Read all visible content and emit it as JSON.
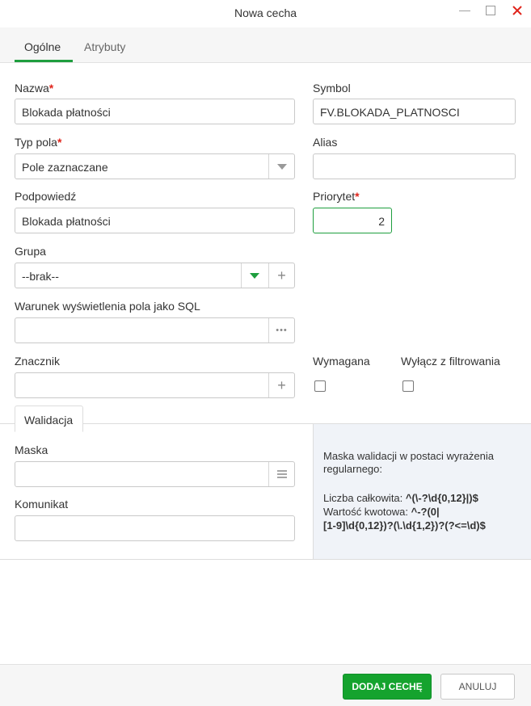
{
  "window": {
    "title": "Nowa cecha",
    "minimize_icon": "minimize-icon",
    "maximize_icon": "maximize-icon",
    "close_icon": "close-icon",
    "close_color": "#e0241b"
  },
  "tabs": [
    {
      "label": "Ogólne",
      "active": true
    },
    {
      "label": "Atrybuty",
      "active": false
    }
  ],
  "accent": "#1e9e3e",
  "form": {
    "name": {
      "label": "Nazwa",
      "required": true,
      "value": "Blokada płatności"
    },
    "symbol": {
      "label": "Symbol",
      "value": "FV.BLOKADA_PLATNOSCI"
    },
    "field_type": {
      "label": "Typ pola",
      "required": true,
      "value": "Pole zaznaczane"
    },
    "alias": {
      "label": "Alias",
      "value": ""
    },
    "hint": {
      "label": "Podpowiedź",
      "value": "Blokada płatności"
    },
    "priority": {
      "label": "Priorytet",
      "required": true,
      "value": "2"
    },
    "group": {
      "label": "Grupa",
      "value": "--brak--"
    },
    "sql_condition": {
      "label": "Warunek wyświetlenia pola jako SQL",
      "value": ""
    },
    "marker": {
      "label": "Znacznik",
      "value": ""
    },
    "required_flag": {
      "label": "Wymagana",
      "checked": false
    },
    "exclude_filter": {
      "label": "Wyłącz z filtrowania",
      "checked": false
    }
  },
  "validation": {
    "tab_label": "Walidacja",
    "mask": {
      "label": "Maska",
      "value": ""
    },
    "message": {
      "label": "Komunikat",
      "value": ""
    },
    "help": {
      "intro": "Maska walidacji w postaci wyrażenia regularnego:",
      "integer_label": "Liczba całkowita: ",
      "integer_regex": "^(\\-?\\d{0,12}|)$",
      "amount_label": "Wartość kwotowa: ",
      "amount_regex_1": "^-?(0|",
      "amount_regex_2": "[1-9]\\d{0,12})?(\\.\\d{1,2})?(?<=\\d)$"
    }
  },
  "footer": {
    "add_label": "DODAJ CECHĘ",
    "cancel_label": "ANULUJ"
  }
}
